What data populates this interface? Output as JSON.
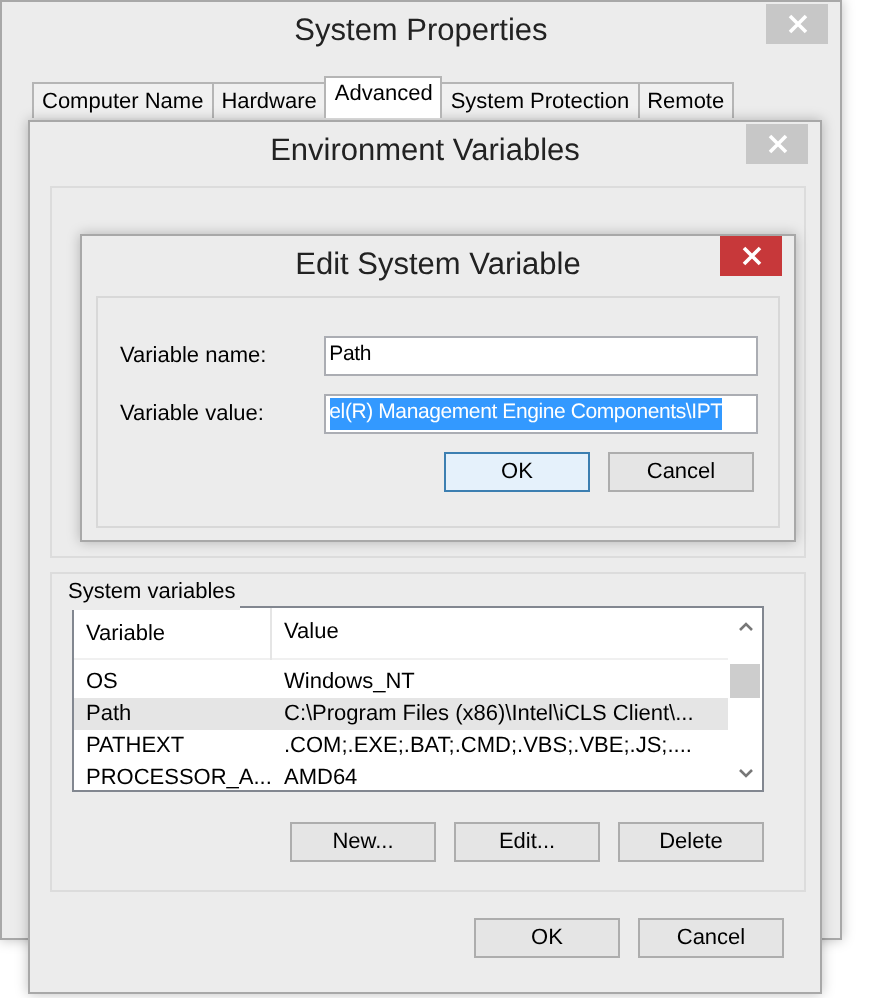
{
  "system_properties": {
    "title": "System Properties",
    "tabs": [
      {
        "label": "Computer Name",
        "selected": false
      },
      {
        "label": "Hardware",
        "selected": false
      },
      {
        "label": "Advanced",
        "selected": true
      },
      {
        "label": "System Protection",
        "selected": false
      },
      {
        "label": "Remote",
        "selected": false
      }
    ]
  },
  "environment_variables": {
    "title": "Environment Variables",
    "system_variables": {
      "label": "System variables",
      "columns": [
        "Variable",
        "Value"
      ],
      "rows": [
        {
          "variable": "OS",
          "value": "Windows_NT",
          "selected": false
        },
        {
          "variable": "Path",
          "value": "C:\\Program Files (x86)\\Intel\\iCLS Client\\...",
          "selected": true
        },
        {
          "variable": "PATHEXT",
          "value": ".COM;.EXE;.BAT;.CMD;.VBS;.VBE;.JS;....",
          "selected": false
        },
        {
          "variable": "PROCESSOR_A...",
          "value": "AMD64",
          "selected": false
        }
      ]
    },
    "list_buttons": [
      "New...",
      "Edit...",
      "Delete"
    ],
    "buttons": [
      "OK",
      "Cancel"
    ]
  },
  "edit_dialog": {
    "title": "Edit System Variable",
    "fields": [
      {
        "label": "Variable name:",
        "value": "Path",
        "selected": false
      },
      {
        "label": "Variable value:",
        "value": "el(R) Management Engine Components\\IPT",
        "selected": true
      }
    ],
    "buttons": [
      {
        "label": "OK",
        "focused": true
      },
      {
        "label": "Cancel",
        "focused": false
      }
    ]
  }
}
